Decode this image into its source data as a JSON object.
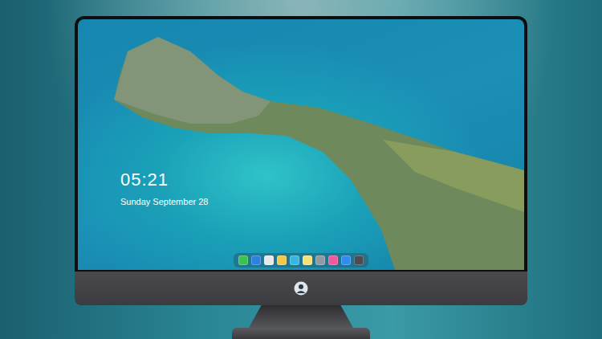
{
  "lock_screen": {
    "time": "05:21",
    "date": "Sunday September 28"
  },
  "dock": {
    "items": [
      {
        "color": "#3cc251"
      },
      {
        "color": "#2f7fe0"
      },
      {
        "color": "#e8e8ea"
      },
      {
        "color": "#f2c84b"
      },
      {
        "color": "#39b6e0"
      },
      {
        "color": "#f7e27a"
      },
      {
        "color": "#8f9aa3"
      },
      {
        "color": "#f05a9a"
      },
      {
        "color": "#2f8cf0"
      },
      {
        "color": "#4a4c50"
      }
    ]
  }
}
